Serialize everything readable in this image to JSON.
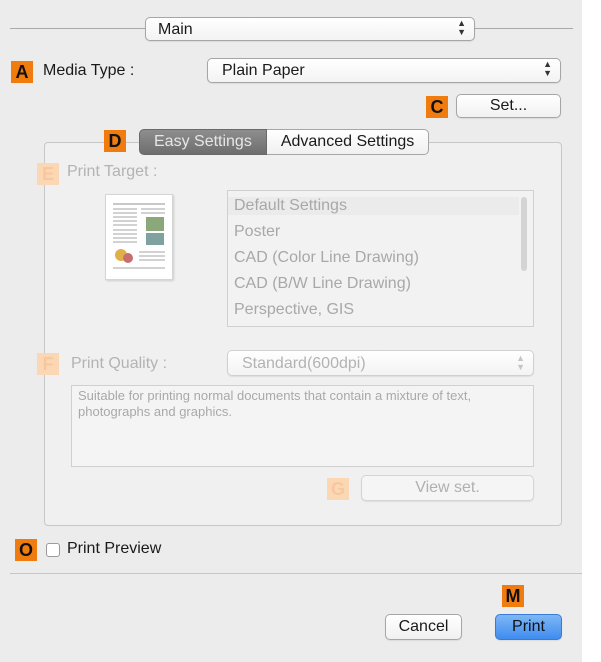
{
  "header": {
    "panel_popup": "Main"
  },
  "badges": {
    "a": "A",
    "c": "C",
    "d": "D",
    "e": "E",
    "f": "F",
    "g": "G",
    "m": "M",
    "o": "O"
  },
  "media_type": {
    "label": "Media Type :",
    "value": "Plain Paper"
  },
  "set_button": "Set...",
  "tabs": [
    {
      "label": "Easy Settings",
      "selected": true
    },
    {
      "label": "Advanced Settings",
      "selected": false
    }
  ],
  "print_target": {
    "label": "Print Target :",
    "items": [
      "Default Settings",
      "Poster",
      "CAD (Color Line Drawing)",
      "CAD (B/W Line Drawing)",
      "Perspective, GIS"
    ],
    "selected_index": 0
  },
  "print_quality": {
    "label": "Print Quality :",
    "value": "Standard(600dpi)",
    "description": "Suitable for printing normal documents that contain a mixture of text, photographs and graphics."
  },
  "view_set_button": "View set.",
  "print_preview": {
    "label": "Print Preview",
    "checked": false
  },
  "footer": {
    "cancel_label": "Cancel",
    "print_label": "Print"
  },
  "colors": {
    "badge": "#f07c10",
    "primary_button": "#3f8cf0",
    "panel_bg": "#ececec"
  }
}
